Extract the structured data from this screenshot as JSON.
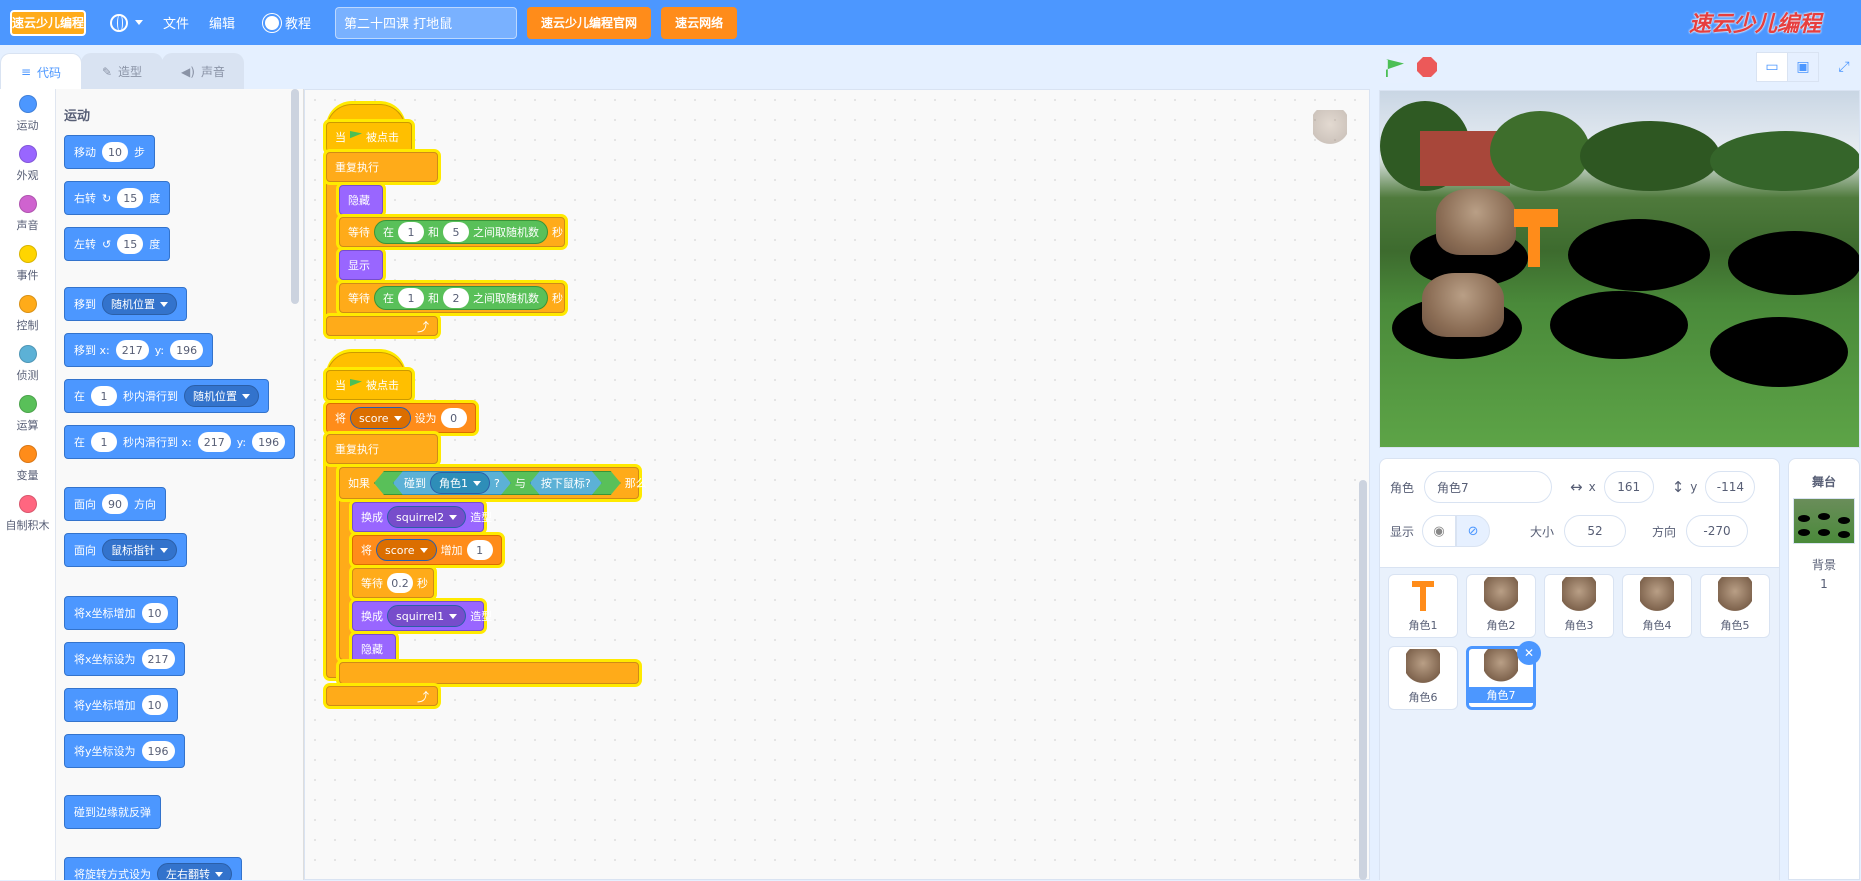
{
  "menubar": {
    "logo": "速云少儿编程",
    "file": "文件",
    "edit": "编辑",
    "tutorials": "教程",
    "project_title": "第二十四课 打地鼠",
    "btn_official": "速云少儿编程官网",
    "btn_network": "速云网络",
    "brand_right": "速云少儿编程"
  },
  "tabs": {
    "code": "代码",
    "costumes": "造型",
    "sounds": "声音"
  },
  "categories": [
    {
      "label": "运动",
      "color": "#4c97ff"
    },
    {
      "label": "外观",
      "color": "#9966ff"
    },
    {
      "label": "声音",
      "color": "#cf63cf"
    },
    {
      "label": "事件",
      "color": "#ffd500"
    },
    {
      "label": "控制",
      "color": "#ffab19"
    },
    {
      "label": "侦测",
      "color": "#5cb1d6"
    },
    {
      "label": "运算",
      "color": "#59c059"
    },
    {
      "label": "变量",
      "color": "#ff8c1a"
    },
    {
      "label": "自制积木",
      "color": "#ff6680"
    }
  ],
  "palette": {
    "heading": "运动",
    "move": {
      "a": "移动",
      "n": "10",
      "b": "步"
    },
    "turn_right": {
      "a": "右转",
      "n": "15",
      "b": "度"
    },
    "turn_left": {
      "a": "左转",
      "n": "15",
      "b": "度"
    },
    "goto": {
      "a": "移到",
      "d": "随机位置"
    },
    "goto_xy": {
      "a": "移到 x:",
      "x": "217",
      "b": "y:",
      "y": "196"
    },
    "glide": {
      "a": "在",
      "n": "1",
      "b": "秒内滑行到",
      "d": "随机位置"
    },
    "glide_xy": {
      "a": "在",
      "n": "1",
      "b": "秒内滑行到 x:",
      "x": "217",
      "c": "y:",
      "y": "196"
    },
    "point_dir": {
      "a": "面向",
      "n": "90",
      "b": "方向"
    },
    "point_towards": {
      "a": "面向",
      "d": "鼠标指针"
    },
    "change_x": {
      "a": "将x坐标增加",
      "n": "10"
    },
    "set_x": {
      "a": "将x坐标设为",
      "n": "217"
    },
    "change_y": {
      "a": "将y坐标增加",
      "n": "10"
    },
    "set_y": {
      "a": "将y坐标设为",
      "n": "196"
    },
    "bounce": {
      "a": "碰到边缘就反弹"
    },
    "rotation": {
      "a": "将旋转方式设为",
      "d": "左右翻转"
    }
  },
  "script1": {
    "hat_a": "当",
    "hat_b": "被点击",
    "forever": "重复执行",
    "hide": "隐藏",
    "wait1_a": "等待",
    "wait1_in": "在",
    "wait1_n1": "1",
    "wait1_and": "和",
    "wait1_n2": "5",
    "wait1_op": "之间取随机数",
    "wait1_b": "秒",
    "show": "显示",
    "wait2_a": "等待",
    "wait2_in": "在",
    "wait2_n1": "1",
    "wait2_and": "和",
    "wait2_n2": "2",
    "wait2_op": "之间取随机数",
    "wait2_b": "秒"
  },
  "script2": {
    "hat_a": "当",
    "hat_b": "被点击",
    "set_a": "将",
    "set_var": "score",
    "set_b": "设为",
    "set_n": "0",
    "forever": "重复执行",
    "if_a": "如果",
    "touch_a": "碰到",
    "touch_d": "角色1",
    "touch_q": "?",
    "and": "与",
    "mouse": "按下鼠标?",
    "then": "那么",
    "sw1_a": "换成",
    "sw1_d": "squirrel2",
    "sw1_b": "造型",
    "chg_a": "将",
    "chg_var": "score",
    "chg_b": "增加",
    "chg_n": "1",
    "wait_a": "等待",
    "wait_n": "0.2",
    "wait_b": "秒",
    "sw2_a": "换成",
    "sw2_d": "squirrel1",
    "sw2_b": "造型",
    "hide": "隐藏"
  },
  "sprite_info": {
    "sprite_label": "角色",
    "sprite_name": "角色7",
    "x_label": "x",
    "x": "161",
    "y_label": "y",
    "y": "-114",
    "show_label": "显示",
    "size_label": "大小",
    "size": "52",
    "dir_label": "方向",
    "direction": "-270"
  },
  "sprites": [
    {
      "name": "角色1",
      "kind": "hammer"
    },
    {
      "name": "角色2",
      "kind": "squirrel"
    },
    {
      "name": "角色3",
      "kind": "squirrel"
    },
    {
      "name": "角色4",
      "kind": "squirrel"
    },
    {
      "name": "角色5",
      "kind": "squirrel"
    },
    {
      "name": "角色6",
      "kind": "squirrel"
    },
    {
      "name": "角色7",
      "kind": "squirrel",
      "selected": true
    }
  ],
  "stage_pane": {
    "title": "舞台",
    "backdrop_label": "背景",
    "backdrop_count": "1"
  }
}
